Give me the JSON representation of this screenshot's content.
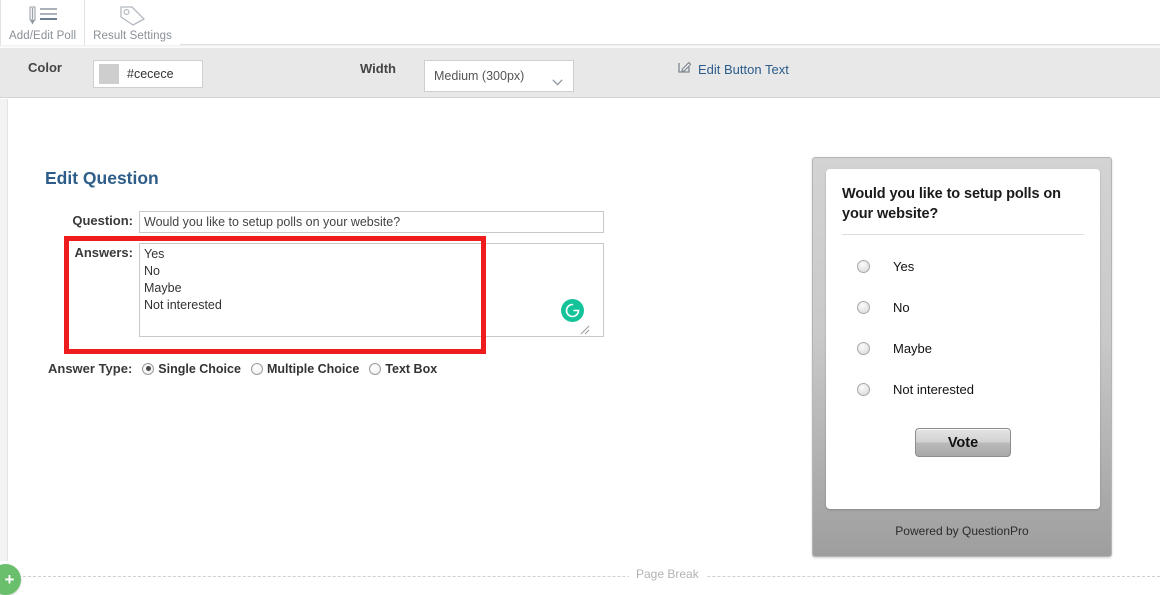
{
  "tabs": [
    {
      "label": "Add/Edit Poll",
      "icon": "edit-list-icon",
      "active": true
    },
    {
      "label": "Result Settings",
      "icon": "tag-icon",
      "active": false
    }
  ],
  "settings": {
    "color_label": "Color",
    "color_value": "#cecece",
    "color_swatch": "#cecece",
    "width_label": "Width",
    "width_value": "Medium (300px)",
    "edit_button_text_link": "Edit Button Text",
    "link_color": "#2b5c8a"
  },
  "form": {
    "title": "Edit Question",
    "question_label": "Question:",
    "question_value": "Would you like to setup polls on your website?",
    "answers_label": "Answers:",
    "answers_value": "Yes\nNo\nMaybe\nNot interested",
    "answer_type_label": "Answer Type:",
    "answer_types": [
      {
        "label": "Single Choice",
        "selected": true
      },
      {
        "label": "Multiple Choice",
        "selected": false
      },
      {
        "label": "Text Box",
        "selected": false
      }
    ],
    "highlight_color": "#ee1c1c",
    "grammarly_icon": "grammarly-g-icon"
  },
  "preview": {
    "question": "Would you like to setup polls on your website?",
    "options": [
      "Yes",
      "No",
      "Maybe",
      "Not interested"
    ],
    "vote_label": "Vote",
    "footer": "Powered by QuestionPro"
  },
  "footer": {
    "page_break_label": "Page Break",
    "add_button_icon": "plus-icon",
    "add_button_color": "#69bf6b"
  }
}
